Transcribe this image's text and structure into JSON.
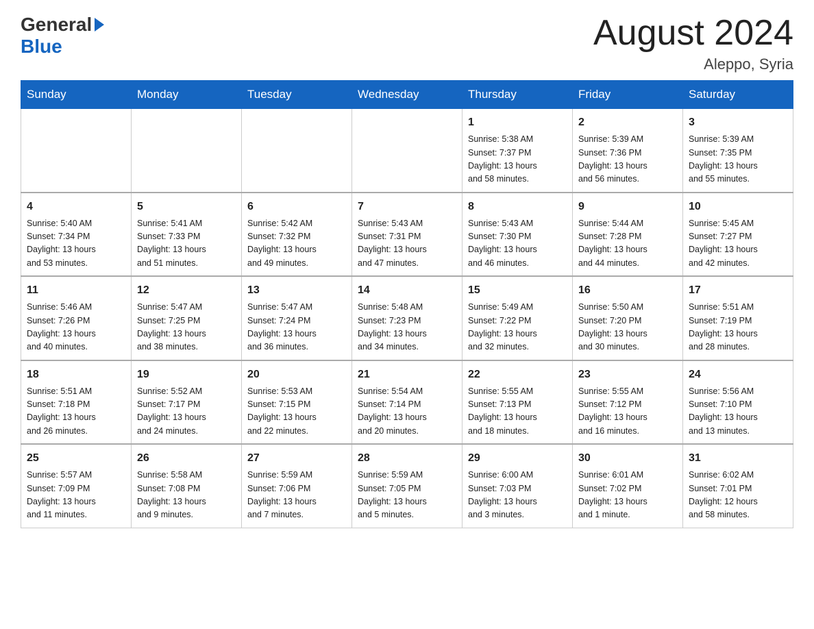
{
  "header": {
    "logo_general": "General",
    "logo_blue": "Blue",
    "month_title": "August 2024",
    "location": "Aleppo, Syria"
  },
  "weekdays": [
    "Sunday",
    "Monday",
    "Tuesday",
    "Wednesday",
    "Thursday",
    "Friday",
    "Saturday"
  ],
  "weeks": [
    [
      {
        "day": "",
        "info": ""
      },
      {
        "day": "",
        "info": ""
      },
      {
        "day": "",
        "info": ""
      },
      {
        "day": "",
        "info": ""
      },
      {
        "day": "1",
        "info": "Sunrise: 5:38 AM\nSunset: 7:37 PM\nDaylight: 13 hours\nand 58 minutes."
      },
      {
        "day": "2",
        "info": "Sunrise: 5:39 AM\nSunset: 7:36 PM\nDaylight: 13 hours\nand 56 minutes."
      },
      {
        "day": "3",
        "info": "Sunrise: 5:39 AM\nSunset: 7:35 PM\nDaylight: 13 hours\nand 55 minutes."
      }
    ],
    [
      {
        "day": "4",
        "info": "Sunrise: 5:40 AM\nSunset: 7:34 PM\nDaylight: 13 hours\nand 53 minutes."
      },
      {
        "day": "5",
        "info": "Sunrise: 5:41 AM\nSunset: 7:33 PM\nDaylight: 13 hours\nand 51 minutes."
      },
      {
        "day": "6",
        "info": "Sunrise: 5:42 AM\nSunset: 7:32 PM\nDaylight: 13 hours\nand 49 minutes."
      },
      {
        "day": "7",
        "info": "Sunrise: 5:43 AM\nSunset: 7:31 PM\nDaylight: 13 hours\nand 47 minutes."
      },
      {
        "day": "8",
        "info": "Sunrise: 5:43 AM\nSunset: 7:30 PM\nDaylight: 13 hours\nand 46 minutes."
      },
      {
        "day": "9",
        "info": "Sunrise: 5:44 AM\nSunset: 7:28 PM\nDaylight: 13 hours\nand 44 minutes."
      },
      {
        "day": "10",
        "info": "Sunrise: 5:45 AM\nSunset: 7:27 PM\nDaylight: 13 hours\nand 42 minutes."
      }
    ],
    [
      {
        "day": "11",
        "info": "Sunrise: 5:46 AM\nSunset: 7:26 PM\nDaylight: 13 hours\nand 40 minutes."
      },
      {
        "day": "12",
        "info": "Sunrise: 5:47 AM\nSunset: 7:25 PM\nDaylight: 13 hours\nand 38 minutes."
      },
      {
        "day": "13",
        "info": "Sunrise: 5:47 AM\nSunset: 7:24 PM\nDaylight: 13 hours\nand 36 minutes."
      },
      {
        "day": "14",
        "info": "Sunrise: 5:48 AM\nSunset: 7:23 PM\nDaylight: 13 hours\nand 34 minutes."
      },
      {
        "day": "15",
        "info": "Sunrise: 5:49 AM\nSunset: 7:22 PM\nDaylight: 13 hours\nand 32 minutes."
      },
      {
        "day": "16",
        "info": "Sunrise: 5:50 AM\nSunset: 7:20 PM\nDaylight: 13 hours\nand 30 minutes."
      },
      {
        "day": "17",
        "info": "Sunrise: 5:51 AM\nSunset: 7:19 PM\nDaylight: 13 hours\nand 28 minutes."
      }
    ],
    [
      {
        "day": "18",
        "info": "Sunrise: 5:51 AM\nSunset: 7:18 PM\nDaylight: 13 hours\nand 26 minutes."
      },
      {
        "day": "19",
        "info": "Sunrise: 5:52 AM\nSunset: 7:17 PM\nDaylight: 13 hours\nand 24 minutes."
      },
      {
        "day": "20",
        "info": "Sunrise: 5:53 AM\nSunset: 7:15 PM\nDaylight: 13 hours\nand 22 minutes."
      },
      {
        "day": "21",
        "info": "Sunrise: 5:54 AM\nSunset: 7:14 PM\nDaylight: 13 hours\nand 20 minutes."
      },
      {
        "day": "22",
        "info": "Sunrise: 5:55 AM\nSunset: 7:13 PM\nDaylight: 13 hours\nand 18 minutes."
      },
      {
        "day": "23",
        "info": "Sunrise: 5:55 AM\nSunset: 7:12 PM\nDaylight: 13 hours\nand 16 minutes."
      },
      {
        "day": "24",
        "info": "Sunrise: 5:56 AM\nSunset: 7:10 PM\nDaylight: 13 hours\nand 13 minutes."
      }
    ],
    [
      {
        "day": "25",
        "info": "Sunrise: 5:57 AM\nSunset: 7:09 PM\nDaylight: 13 hours\nand 11 minutes."
      },
      {
        "day": "26",
        "info": "Sunrise: 5:58 AM\nSunset: 7:08 PM\nDaylight: 13 hours\nand 9 minutes."
      },
      {
        "day": "27",
        "info": "Sunrise: 5:59 AM\nSunset: 7:06 PM\nDaylight: 13 hours\nand 7 minutes."
      },
      {
        "day": "28",
        "info": "Sunrise: 5:59 AM\nSunset: 7:05 PM\nDaylight: 13 hours\nand 5 minutes."
      },
      {
        "day": "29",
        "info": "Sunrise: 6:00 AM\nSunset: 7:03 PM\nDaylight: 13 hours\nand 3 minutes."
      },
      {
        "day": "30",
        "info": "Sunrise: 6:01 AM\nSunset: 7:02 PM\nDaylight: 13 hours\nand 1 minute."
      },
      {
        "day": "31",
        "info": "Sunrise: 6:02 AM\nSunset: 7:01 PM\nDaylight: 12 hours\nand 58 minutes."
      }
    ]
  ]
}
